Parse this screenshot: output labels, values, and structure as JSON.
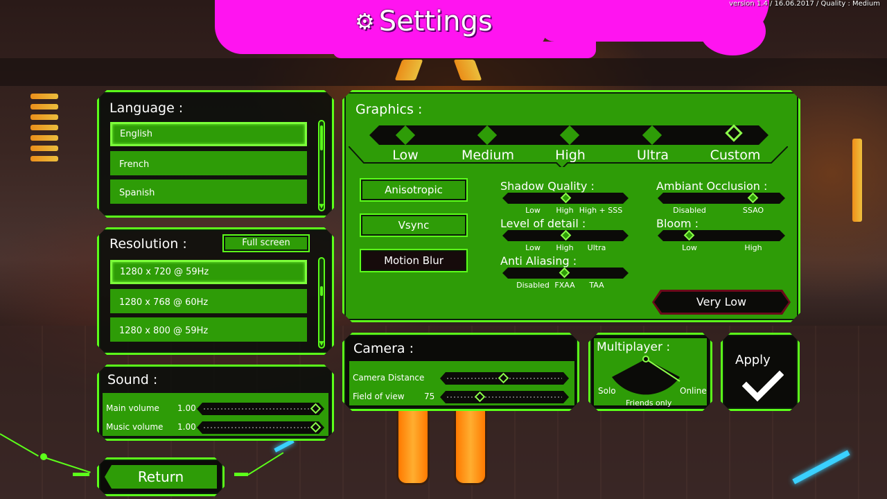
{
  "window": {
    "title": "Settings",
    "version_text": "version 1.4 / 16.06.2017 / Quality : Medium"
  },
  "language": {
    "header": "Language :",
    "items": [
      "English",
      "French",
      "Spanish"
    ],
    "selected": "English"
  },
  "resolution": {
    "header": "Resolution :",
    "fullscreen_label": "Full screen",
    "items": [
      "1280 x 720 @ 59Hz",
      "1280 x 768 @ 60Hz",
      "1280 x 800 @ 59Hz"
    ],
    "selected": "1280 x 720 @ 59Hz"
  },
  "sound": {
    "header": "Sound :",
    "main_volume_label": "Main volume",
    "main_volume_value": "1.00",
    "music_volume_label": "Music volume",
    "music_volume_value": "1.00"
  },
  "return_label": "Return",
  "graphics": {
    "header": "Graphics :",
    "presets": [
      "Low",
      "Medium",
      "High",
      "Ultra",
      "Custom"
    ],
    "selected_preset": "Custom",
    "toggles": {
      "anisotropic": "Anisotropic",
      "vsync": "Vsync",
      "motion_blur": "Motion Blur"
    },
    "shadow_quality": {
      "title": "Shadow Quality :",
      "options": [
        "Low",
        "High",
        "High + SSS"
      ],
      "selected": "High"
    },
    "level_of_detail": {
      "title": "Level of detail :",
      "options": [
        "Low",
        "High",
        "Ultra"
      ],
      "selected": "High"
    },
    "anti_aliasing": {
      "title": "Anti Aliasing :",
      "options": [
        "Disabled",
        "FXAA",
        "TAA"
      ],
      "selected": "FXAA"
    },
    "ambiant_occlusion": {
      "title": "Ambiant Occlusion :",
      "options": [
        "Disabled",
        "SSAO"
      ],
      "selected": "SSAO"
    },
    "bloom": {
      "title": "Bloom :",
      "options": [
        "Low",
        "High"
      ],
      "selected": "Low"
    },
    "very_low_label": "Very Low"
  },
  "camera": {
    "header": "Camera :",
    "distance_label": "Camera Distance",
    "fov_label": "Field of view",
    "fov_value": "75"
  },
  "multiplayer": {
    "header": "Multiplayer :",
    "options": [
      "Solo",
      "Friends only",
      "Online"
    ]
  },
  "apply_label": "Apply",
  "colors": {
    "accent": "#5cff1a",
    "panel_fill": "#2e9c07",
    "title_bg": "#ff14f0"
  }
}
